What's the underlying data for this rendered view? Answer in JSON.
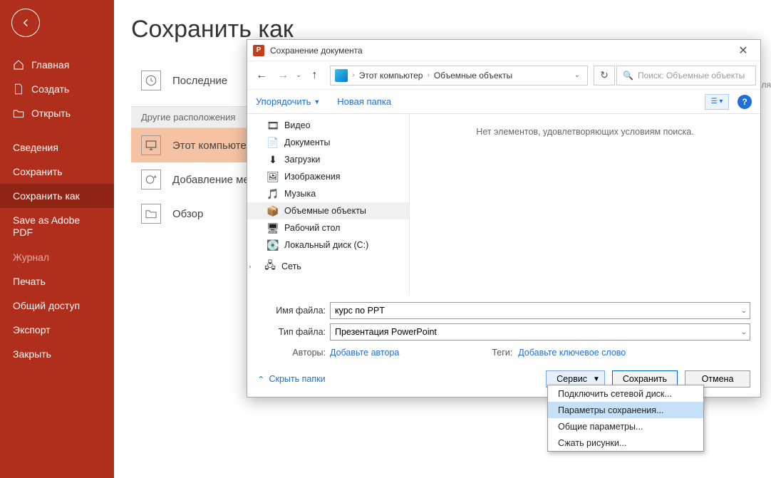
{
  "sidebar": {
    "items": [
      {
        "label": "Главная"
      },
      {
        "label": "Создать"
      },
      {
        "label": "Открыть"
      },
      {
        "label": "Сведения"
      },
      {
        "label": "Сохранить"
      },
      {
        "label": "Сохранить как"
      },
      {
        "label": "Save as Adobe PDF"
      },
      {
        "label": "Журнал"
      },
      {
        "label": "Печать"
      },
      {
        "label": "Общий доступ"
      },
      {
        "label": "Экспорт"
      },
      {
        "label": "Закрыть"
      }
    ]
  },
  "page": {
    "title": "Сохранить как"
  },
  "locations": {
    "recent": "Последние",
    "section": "Другие расположения",
    "this_pc": "Этот компьютер",
    "add_place": "Добавление места",
    "browse": "Обзор",
    "add_place_truncated": "Добавление ме"
  },
  "right_cut": "оявля",
  "dialog": {
    "title": "Сохранение документа",
    "breadcrumb": {
      "seg1": "Этот компьютер",
      "seg2": "Объемные объекты"
    },
    "search_placeholder": "Поиск: Объемные объекты",
    "toolbar": {
      "organize": "Упорядочить",
      "new_folder": "Новая папка"
    },
    "tree": [
      {
        "label": "Видео",
        "icon": "🎞"
      },
      {
        "label": "Документы",
        "icon": "📄"
      },
      {
        "label": "Загрузки",
        "icon": "⬇"
      },
      {
        "label": "Изображения",
        "icon": "🖼"
      },
      {
        "label": "Музыка",
        "icon": "🎵"
      },
      {
        "label": "Объемные объекты",
        "icon": "📦"
      },
      {
        "label": "Рабочий стол",
        "icon": "🖥"
      },
      {
        "label": "Локальный диск (C:)",
        "icon": "💽"
      }
    ],
    "network_label": "Сеть",
    "empty_msg": "Нет элементов, удовлетворяющих условиям поиска.",
    "form": {
      "filename_label": "Имя файла:",
      "filename_value": "курс по PPT",
      "filetype_label": "Тип файла:",
      "filetype_value": "Презентация PowerPoint",
      "authors_label": "Авторы:",
      "authors_value": "Добавьте автора",
      "tags_label": "Теги:",
      "tags_value": "Добавьте ключевое слово"
    },
    "footer": {
      "hide": "Скрыть папки",
      "tools": "Сервис",
      "save": "Сохранить",
      "cancel": "Отмена"
    }
  },
  "menu": {
    "items": [
      "Подключить сетевой диск...",
      "Параметры сохранения...",
      "Общие параметры...",
      "Сжать рисунки..."
    ]
  }
}
